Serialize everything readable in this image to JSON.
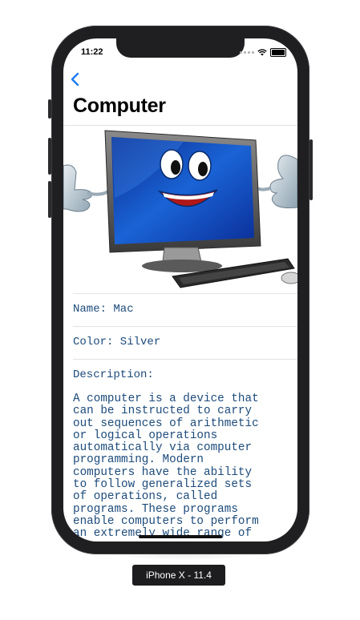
{
  "status_bar": {
    "time": "11:22"
  },
  "nav": {
    "title": "Computer"
  },
  "details": {
    "name": "Name: Mac",
    "color": "Color: Silver",
    "description_label": "Description:",
    "description_lines": [
      "A computer is a device that",
      "can be instructed to carry",
      "out sequences of arithmetic",
      "or logical operations",
      "automatically via computer",
      "programming. Modern",
      "computers have the ability",
      "to follow generalized sets",
      "of operations, called",
      "programs. These programs",
      "enable computers to perform",
      "an extremely wide range of"
    ]
  },
  "icons": {
    "back": "chevron-left-icon",
    "signal": "cellular-dots-icon",
    "wifi": "wifi-icon",
    "battery": "battery-icon"
  },
  "colors": {
    "accent": "#1b7cf5",
    "text": "#1c4a7a"
  },
  "simulator": {
    "device_label": "iPhone X - 11.4"
  }
}
